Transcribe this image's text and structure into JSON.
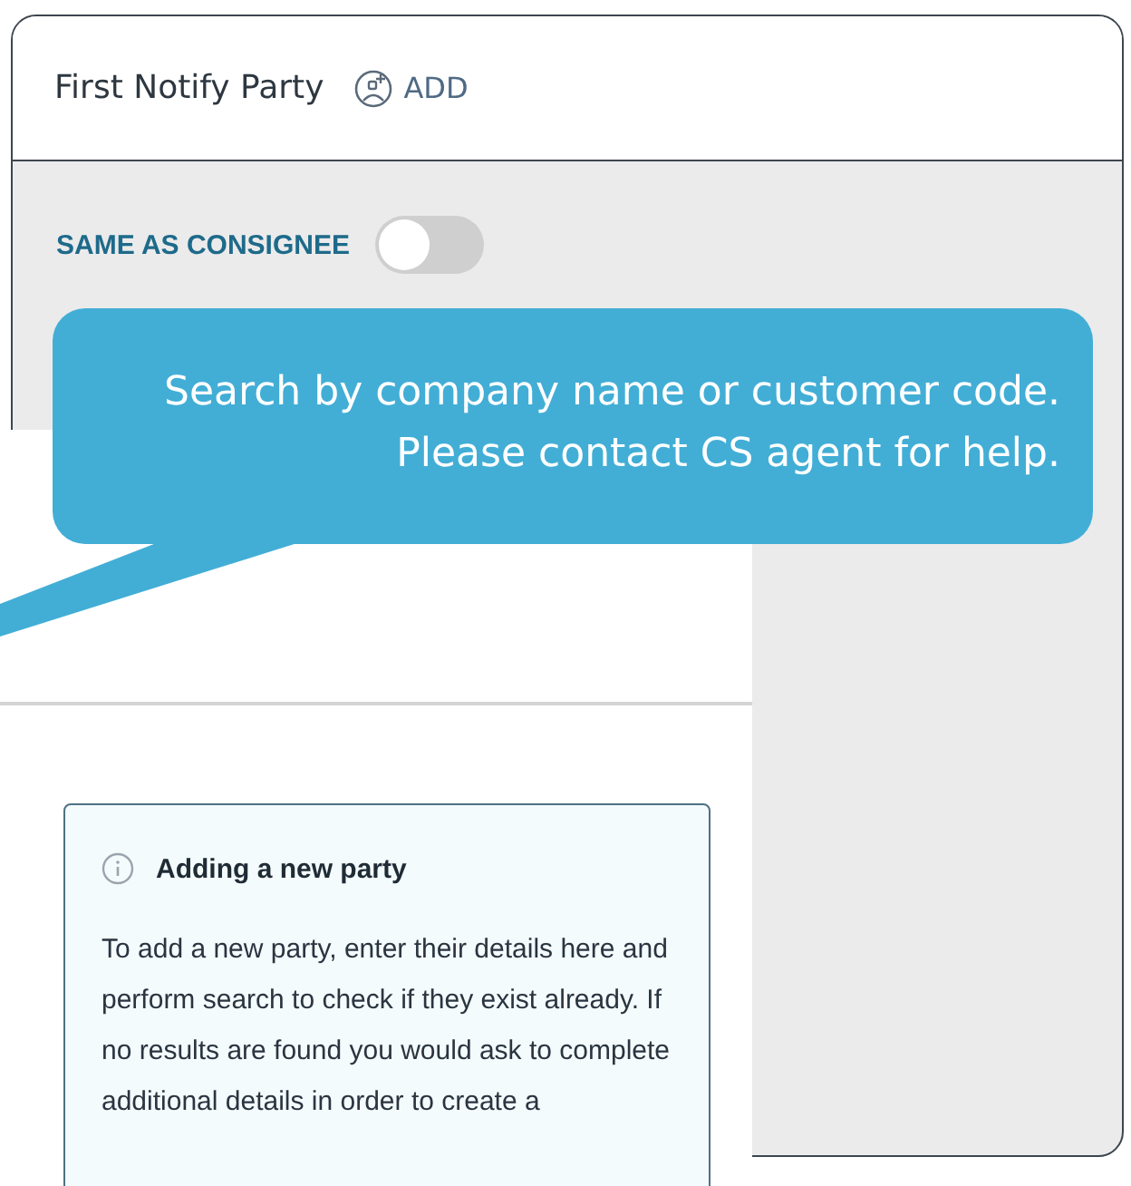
{
  "card": {
    "title": "First Notify Party",
    "add_label": "ADD"
  },
  "same_as_consignee": {
    "label": "SAME AS CONSIGNEE",
    "on": false
  },
  "tooltip": {
    "text": "Search by company name or customer code. Please contact CS agent for help."
  },
  "info_box": {
    "title": "Adding a new party",
    "text": "To add a new party, enter their details here and perform search to check if they exist already. If no results are found you would ask to complete additional details in order to create a"
  }
}
